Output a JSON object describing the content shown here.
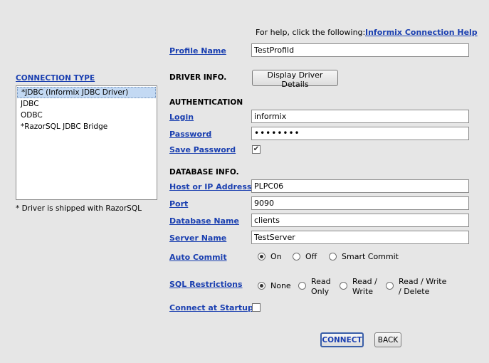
{
  "help": {
    "prefix": "For help, click the following:",
    "link": "Informix Connection Help"
  },
  "connection_type": {
    "heading": "CONNECTION TYPE",
    "items": [
      {
        "label": "*JDBC (Informix JDBC Driver)",
        "selected": true
      },
      {
        "label": "JDBC",
        "selected": false
      },
      {
        "label": "ODBC",
        "selected": false
      },
      {
        "label": "*RazorSQL JDBC Bridge",
        "selected": false
      }
    ],
    "note": "* Driver is shipped with RazorSQL"
  },
  "profile": {
    "label": "Profile Name",
    "value": "TestProfild"
  },
  "driver": {
    "heading": "DRIVER INFO.",
    "button": "Display Driver Details"
  },
  "auth": {
    "heading": "AUTHENTICATION",
    "login_label": "Login",
    "login_value": "informix",
    "password_label": "Password",
    "password_value": "••••••••",
    "save_password_label": "Save Password",
    "save_password_checked": true,
    "check_mark": "✔"
  },
  "database": {
    "heading": "DATABASE INFO.",
    "host_label": "Host or IP Address",
    "host_value": "PLPC06",
    "port_label": "Port",
    "port_value": "9090",
    "dbname_label": "Database Name",
    "dbname_value": "clients",
    "server_label": "Server Name",
    "server_value": "TestServer"
  },
  "auto_commit": {
    "label": "Auto Commit",
    "options": [
      "On",
      "Off",
      "Smart Commit"
    ],
    "selected": "On"
  },
  "sql_restrictions": {
    "label": "SQL Restrictions",
    "options": [
      {
        "line1": "None",
        "line2": ""
      },
      {
        "line1": "Read",
        "line2": "Only"
      },
      {
        "line1": "Read /",
        "line2": "Write"
      },
      {
        "line1": "Read / Write",
        "line2": "/ Delete"
      }
    ],
    "selected": "None"
  },
  "startup": {
    "label": "Connect at Startup",
    "checked": false
  },
  "buttons": {
    "connect": "CONNECT",
    "back": "BACK"
  }
}
